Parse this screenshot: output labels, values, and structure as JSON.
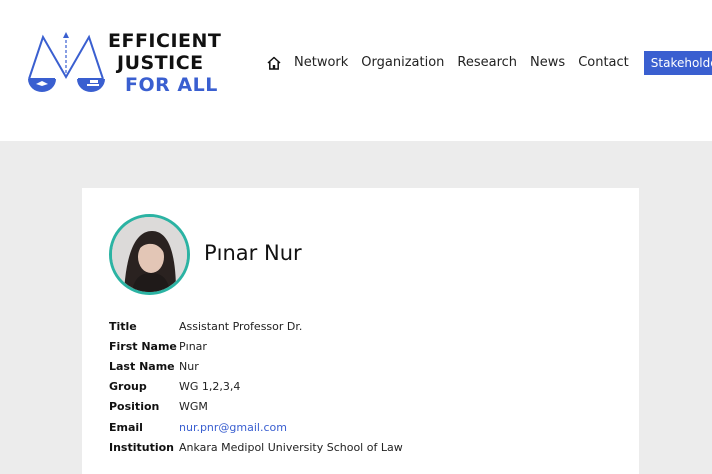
{
  "logo": {
    "line1": "EFFICIENT",
    "line2": "JUSTICE",
    "line3": "FOR ALL",
    "colors": {
      "brand": "#3a5fd0",
      "text": "#111111"
    }
  },
  "nav": {
    "home_icon": "home-icon",
    "items": [
      "Network",
      "Organization",
      "Research",
      "News",
      "Contact"
    ],
    "cta": "Stakeholders"
  },
  "profile": {
    "name": "Pınar Nur",
    "avatar_ring_color": "#2bb3a3",
    "fields": [
      {
        "label": "Title",
        "value": "Assistant Professor Dr."
      },
      {
        "label": "First Name",
        "value": "Pınar"
      },
      {
        "label": "Last Name",
        "value": "Nur"
      },
      {
        "label": "Group",
        "value": "WG 1,2,3,4"
      },
      {
        "label": "Position",
        "value": "WGM"
      },
      {
        "label": "Email",
        "value": "nur.pnr@gmail.com"
      },
      {
        "label": "Institution",
        "value": "Ankara Medipol University School of Law"
      }
    ]
  }
}
